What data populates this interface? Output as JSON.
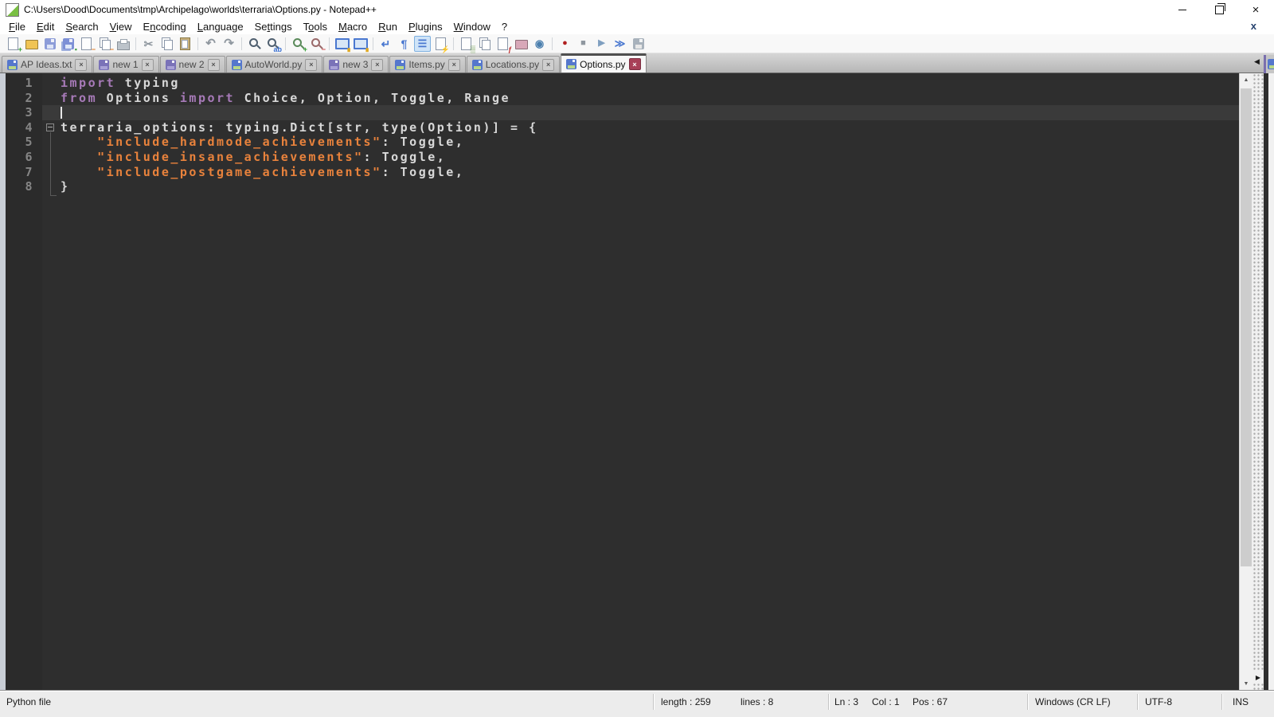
{
  "window": {
    "title": "C:\\Users\\Dood\\Documents\\tmp\\Archipelago\\worlds\\terraria\\Options.py - Notepad++",
    "close_glyph": "×"
  },
  "menubar": {
    "items": [
      {
        "label": "File",
        "u": 0
      },
      {
        "label": "Edit",
        "u": 0
      },
      {
        "label": "Search",
        "u": 0
      },
      {
        "label": "View",
        "u": 0
      },
      {
        "label": "Encoding",
        "u": 1
      },
      {
        "label": "Language",
        "u": 0
      },
      {
        "label": "Settings",
        "u": 2
      },
      {
        "label": "Tools",
        "u": 1
      },
      {
        "label": "Macro",
        "u": 0
      },
      {
        "label": "Run",
        "u": 0
      },
      {
        "label": "Plugins",
        "u": 0
      },
      {
        "label": "Window",
        "u": 0
      },
      {
        "label": "?",
        "u": -1
      }
    ],
    "close_glyph": "x"
  },
  "toolbar": {
    "groups": [
      [
        {
          "n": "new-file",
          "k": "page",
          "badge": "+",
          "bc": "#2f9e2f"
        },
        {
          "n": "open-file",
          "k": "folder",
          "c": "#f0c455"
        },
        {
          "n": "save-file",
          "k": "disk",
          "c": "#8c9cd8",
          "lc": "#dde4f6"
        },
        {
          "n": "save-all",
          "k": "disk2",
          "c": "#7d90d6",
          "badge": "▪",
          "bc": "#3f9e3f"
        },
        {
          "n": "close-file",
          "k": "page",
          "badge": "−",
          "bc": "#e07820"
        },
        {
          "n": "close-all",
          "k": "pages",
          "badge": "−",
          "bc": "#e07820"
        },
        {
          "n": "print",
          "k": "printer"
        }
      ],
      [
        {
          "n": "cut",
          "k": "glyph",
          "g": "✂",
          "c": "#8f979f",
          "fs": 14
        },
        {
          "n": "copy",
          "k": "pages"
        },
        {
          "n": "paste",
          "k": "clip",
          "c": "#c8b07a"
        }
      ],
      [
        {
          "n": "undo",
          "k": "glyph",
          "g": "↶",
          "c": "#8f979f",
          "fs": 15
        },
        {
          "n": "redo",
          "k": "glyph",
          "g": "↷",
          "c": "#8f979f",
          "fs": 15
        }
      ],
      [
        {
          "n": "find",
          "k": "mag",
          "c": "#4f5f6f"
        },
        {
          "n": "replace",
          "k": "mag",
          "c": "#4f5f6f",
          "badge": "ab",
          "bc": "#3a6fd0"
        }
      ],
      [
        {
          "n": "zoom-in",
          "k": "mag",
          "c": "#5a8a5a",
          "badge": "+",
          "bc": "#2f9e2f"
        },
        {
          "n": "zoom-out",
          "k": "mag",
          "c": "#9a6a6a",
          "badge": "−",
          "bc": "#d04545"
        }
      ],
      [
        {
          "n": "sync-vertical-scroll",
          "k": "mon",
          "badge": "∎",
          "bc": "#e0a820"
        },
        {
          "n": "sync-horizontal-scroll",
          "k": "mon",
          "badge": "∎",
          "bc": "#e0a820"
        }
      ],
      [
        {
          "n": "word-wrap",
          "k": "glyph",
          "g": "↵",
          "c": "#4a78d0",
          "fs": 14
        },
        {
          "n": "show-all-characters",
          "k": "glyph",
          "g": "¶",
          "c": "#4a78d0",
          "fs": 14
        },
        {
          "n": "show-indent-guide",
          "k": "glyph",
          "g": "☰",
          "c": "#4a78d0",
          "fs": 13,
          "active": true
        },
        {
          "n": "define-language",
          "k": "page",
          "badge": "⚡",
          "bc": "#e0a820"
        }
      ],
      [
        {
          "n": "document-map",
          "k": "page",
          "badge": "▒",
          "bc": "#6a9a4a"
        },
        {
          "n": "document-switcher",
          "k": "pages"
        },
        {
          "n": "function-list",
          "k": "page",
          "badge": "ƒ",
          "bc": "#c03030"
        },
        {
          "n": "folder-as-workspace",
          "k": "folder",
          "c": "#d8a8b8"
        },
        {
          "n": "monitoring-eye",
          "k": "glyph",
          "g": "◉",
          "c": "#4b7fae",
          "fs": 13
        }
      ],
      [
        {
          "n": "start-recording-macro",
          "k": "glyph",
          "g": "●",
          "c": "#b02020",
          "fs": 11
        },
        {
          "n": "stop-recording-macro",
          "k": "glyph",
          "g": "■",
          "c": "#8f979f",
          "fs": 11
        },
        {
          "n": "playback-macro",
          "k": "glyph",
          "g": "▶",
          "c": "#7f9fc0",
          "fs": 11
        },
        {
          "n": "run-macro-multiple-times",
          "k": "glyph",
          "g": "≫",
          "c": "#4a78d0",
          "fs": 13
        },
        {
          "n": "save-recorded-macro",
          "k": "disk",
          "c": "#a8b2bc",
          "lc": "#e8e8e8"
        }
      ]
    ]
  },
  "tabbar": {
    "tabs": [
      {
        "label": "AP Ideas.txt",
        "icon": "file",
        "active": false
      },
      {
        "label": "new 1",
        "icon": "new",
        "active": false
      },
      {
        "label": "new 2",
        "icon": "new",
        "active": false
      },
      {
        "label": "AutoWorld.py",
        "icon": "file",
        "active": false
      },
      {
        "label": "new 3",
        "icon": "new",
        "active": false
      },
      {
        "label": "Items.py",
        "icon": "file",
        "active": false
      },
      {
        "label": "Locations.py",
        "icon": "file",
        "active": false
      },
      {
        "label": "Options.py",
        "icon": "file",
        "active": true
      }
    ],
    "icon_colors": {
      "file": {
        "body": "#5577cc",
        "label": "#b8d788"
      },
      "new": {
        "body": "#7a72b8",
        "label": "#a9a2d6"
      }
    },
    "close_glyph": "×",
    "scroll_left_glyph": "◀",
    "scroll_right_glyph": "▶"
  },
  "editor": {
    "current_line": 3,
    "caret": {
      "line": 3,
      "col": 1
    },
    "fold": {
      "start": 4,
      "end": 7
    },
    "colors": {
      "kw": "#a77ab8",
      "str": "#e8823c",
      "df": "#d8d8d8"
    },
    "scrollbar": {
      "up": "▲",
      "down": "▼"
    },
    "lines": [
      {
        "num": 1,
        "tokens": [
          {
            "t": "import",
            "c": "kw"
          },
          {
            "t": " typing",
            "c": "df"
          }
        ]
      },
      {
        "num": 2,
        "tokens": [
          {
            "t": "from",
            "c": "kw"
          },
          {
            "t": " Options ",
            "c": "df"
          },
          {
            "t": "import",
            "c": "kw"
          },
          {
            "t": " Choice, Option, Toggle, Range",
            "c": "df"
          }
        ]
      },
      {
        "num": 3,
        "tokens": []
      },
      {
        "num": 4,
        "tokens": [
          {
            "t": "terraria_options: typing.Dict[str, type(Option)] = {",
            "c": "df"
          }
        ]
      },
      {
        "num": 5,
        "tokens": [
          {
            "t": "    ",
            "c": "df"
          },
          {
            "t": "\"include_hardmode_achievements\"",
            "c": "str"
          },
          {
            "t": ": Toggle,",
            "c": "df"
          }
        ]
      },
      {
        "num": 6,
        "tokens": [
          {
            "t": "    ",
            "c": "df"
          },
          {
            "t": "\"include_insane_achievements\"",
            "c": "str"
          },
          {
            "t": ": Toggle,",
            "c": "df"
          }
        ]
      },
      {
        "num": 7,
        "tokens": [
          {
            "t": "    ",
            "c": "df"
          },
          {
            "t": "\"include_postgame_achievements\"",
            "c": "str"
          },
          {
            "t": ": Toggle,",
            "c": "df"
          }
        ]
      },
      {
        "num": 8,
        "tokens": [
          {
            "t": "}",
            "c": "df"
          }
        ]
      }
    ]
  },
  "statusbar": {
    "doc_type": "Python file",
    "length": "length : 259",
    "lines": "lines : 8",
    "ln": "Ln : 3",
    "col": "Col : 1",
    "pos": "Pos : 67",
    "eol": "Windows (CR LF)",
    "encoding": "UTF-8",
    "mode": "INS"
  }
}
